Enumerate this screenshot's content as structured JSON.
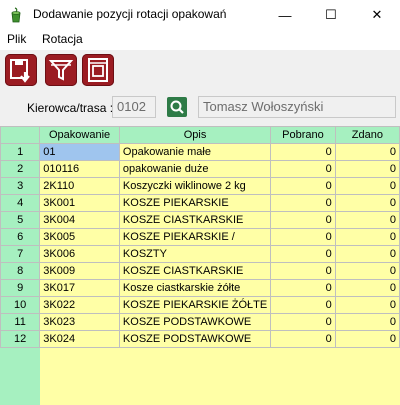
{
  "window": {
    "title": "Dodawanie pozycji rotacji opakowań",
    "minimize_glyph": "—",
    "maximize_glyph": "☐",
    "close_glyph": "✕"
  },
  "menu": [
    "Plik",
    "Rotacja"
  ],
  "toolbar": {
    "buttons": [
      {
        "icon": "save-icon"
      },
      {
        "icon": "filter-icon"
      },
      {
        "icon": "print-icon"
      }
    ],
    "accent_color": "#9b1c22"
  },
  "filter": {
    "driver_label": "Kierowca/trasa :",
    "driver_code": "0102",
    "driver_name": "Tomasz Wołoszyński",
    "search_icon": "search-icon"
  },
  "table": {
    "columns": [
      "",
      "Opakowanie",
      "Opis",
      "Pobrano",
      "Zdano"
    ],
    "rows": [
      {
        "nr": "1",
        "code": "01",
        "desc": "Opakowanie małe",
        "taken": "0",
        "returned": "0"
      },
      {
        "nr": "2",
        "code": "010116",
        "desc": "opakowanie duże",
        "taken": "0",
        "returned": "0"
      },
      {
        "nr": "3",
        "code": "2K110",
        "desc": "Koszyczki wiklinowe 2 kg",
        "taken": "0",
        "returned": "0"
      },
      {
        "nr": "4",
        "code": "3K001",
        "desc": "KOSZE PIEKARSKIE",
        "taken": "0",
        "returned": "0"
      },
      {
        "nr": "5",
        "code": "3K004",
        "desc": "KOSZE CIASTKARSKIE",
        "taken": "0",
        "returned": "0"
      },
      {
        "nr": "6",
        "code": "3K005",
        "desc": "KOSZE PIEKARSKIE /",
        "taken": "0",
        "returned": "0"
      },
      {
        "nr": "7",
        "code": "3K006",
        "desc": "KOSZTY",
        "taken": "0",
        "returned": "0"
      },
      {
        "nr": "8",
        "code": "3K009",
        "desc": "KOSZE CIASTKARSKIE",
        "taken": "0",
        "returned": "0"
      },
      {
        "nr": "9",
        "code": "3K017",
        "desc": "Kosze ciastkarskie żółte",
        "taken": "0",
        "returned": "0"
      },
      {
        "nr": "10",
        "code": "3K022",
        "desc": "KOSZE PIEKARSKIE ŻÓŁTE",
        "taken": "0",
        "returned": "0"
      },
      {
        "nr": "11",
        "code": "3K023",
        "desc": "KOSZE PODSTAWKOWE",
        "taken": "0",
        "returned": "0"
      },
      {
        "nr": "12",
        "code": "3K024",
        "desc": "KOSZE PODSTAWKOWE",
        "taken": "0",
        "returned": "0"
      }
    ],
    "selected_cell": {
      "row": 1,
      "column": "Opakowanie"
    },
    "header_color": "#a6f0c0",
    "cell_color": "#ffffa6",
    "selection_color": "#9fc5ee"
  }
}
